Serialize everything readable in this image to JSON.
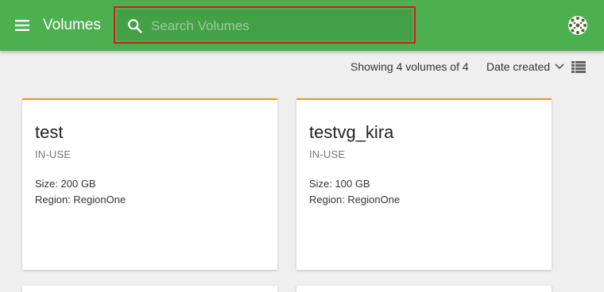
{
  "header": {
    "title": "Volumes",
    "search_placeholder": "Search Volumes",
    "search_value": ""
  },
  "toolbar": {
    "count_text": "Showing 4 volumes of 4",
    "sort_label": "Date created"
  },
  "volumes": [
    {
      "name": "test",
      "status": "IN-USE",
      "size": "Size: 200 GB",
      "region": "Region: RegionOne"
    },
    {
      "name": "testvg_kira",
      "status": "IN-USE",
      "size": "Size: 100 GB",
      "region": "Region: RegionOne"
    }
  ],
  "colors": {
    "appbar": "#4caf50",
    "accent_border": "#f7941d",
    "highlight": "#d01f1f"
  },
  "icons": {
    "menu": "hamburger-icon",
    "search": "search-icon",
    "avatar": "avatar-icon",
    "sort": "chevron-down-icon",
    "view": "list-view-icon"
  }
}
